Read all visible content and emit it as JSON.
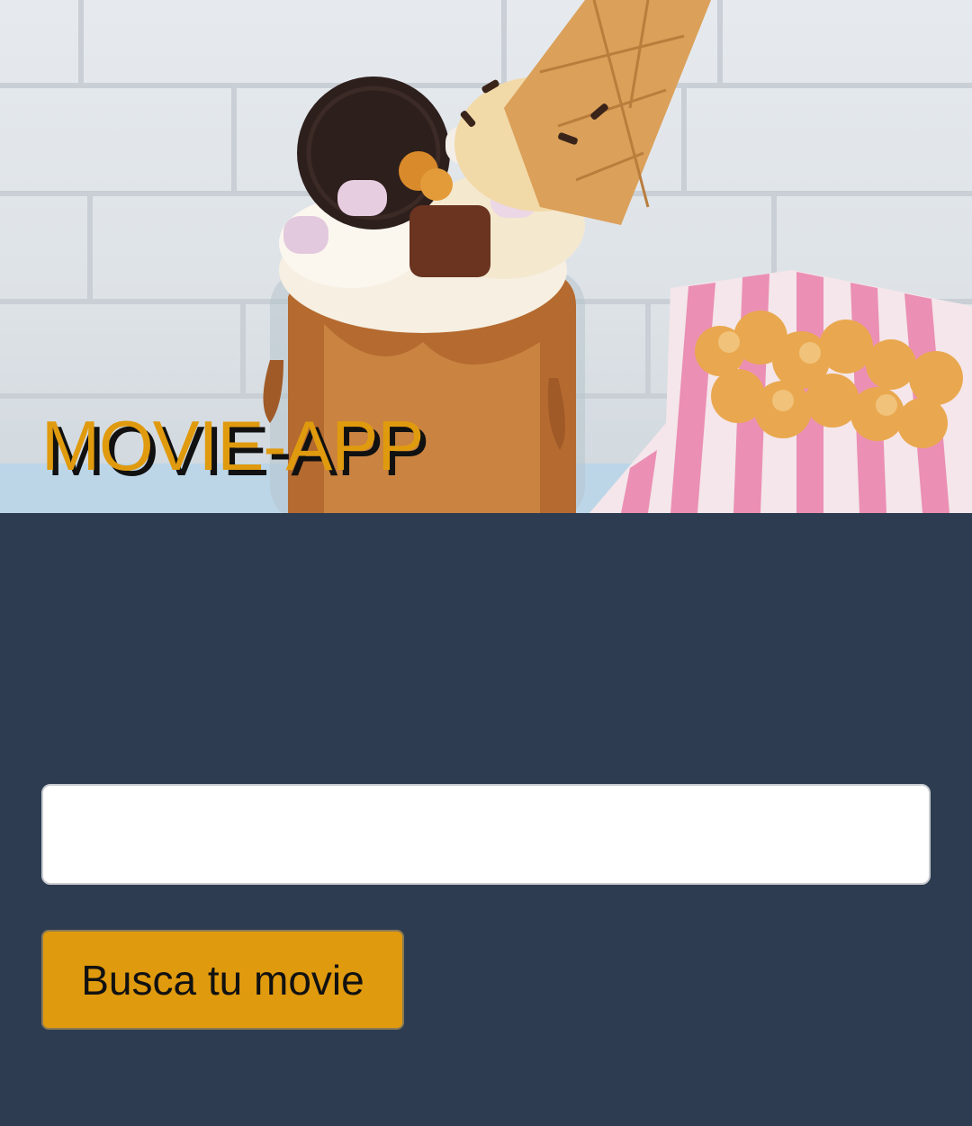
{
  "header": {
    "title": "MOVIE-APP",
    "hero_image": "freakshake-and-popcorn-photo"
  },
  "search": {
    "value": "",
    "placeholder": ""
  },
  "actions": {
    "search_button_label": "Busca tu movie"
  },
  "colors": {
    "background": "#2d3c50",
    "accent": "#e09a0e",
    "title_shadow": "#111111",
    "input_background": "#ffffff"
  }
}
